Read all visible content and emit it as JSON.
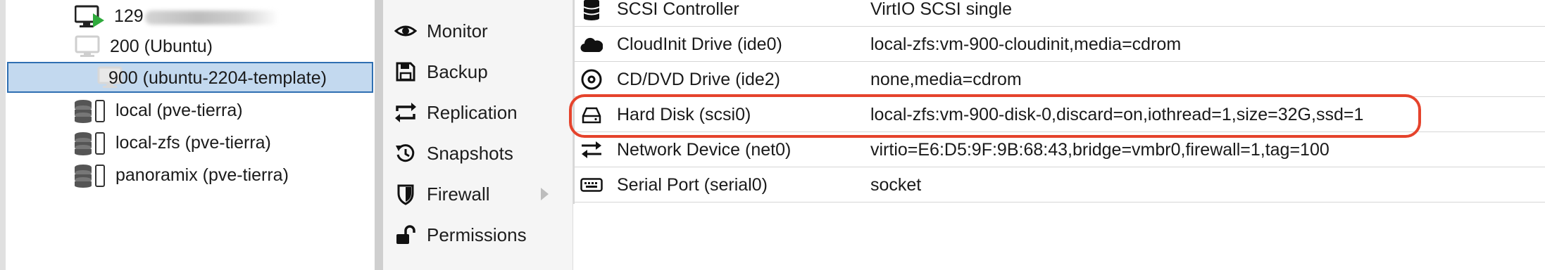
{
  "tree": {
    "items": [
      {
        "label": "129",
        "icon": "vm-running-icon",
        "redacted": true
      },
      {
        "label": "200 (Ubuntu)",
        "icon": "vm-stopped-icon"
      },
      {
        "label": "900 (ubuntu-2204-template)",
        "icon": "vm-template-icon",
        "selected": true
      },
      {
        "label": "local (pve-tierra)",
        "icon": "storage-icon"
      },
      {
        "label": "local-zfs (pve-tierra)",
        "icon": "storage-icon"
      },
      {
        "label": "panoramix (pve-tierra)",
        "icon": "storage-icon"
      }
    ]
  },
  "menu": {
    "items": [
      {
        "label": "Monitor",
        "icon": "eye-icon"
      },
      {
        "label": "Backup",
        "icon": "floppy-icon"
      },
      {
        "label": "Replication",
        "icon": "replication-icon"
      },
      {
        "label": "Snapshots",
        "icon": "history-icon"
      },
      {
        "label": "Firewall",
        "icon": "shield-icon",
        "has_submenu": true
      },
      {
        "label": "Permissions",
        "icon": "unlock-icon"
      }
    ]
  },
  "hardware": {
    "rows": [
      {
        "name": "SCSI Controller",
        "value": "VirtIO SCSI single",
        "icon": "database-icon"
      },
      {
        "name": "CloudInit Drive (ide0)",
        "value": "local-zfs:vm-900-cloudinit,media=cdrom",
        "icon": "cloud-icon"
      },
      {
        "name": "CD/DVD Drive (ide2)",
        "value": "none,media=cdrom",
        "icon": "disc-icon"
      },
      {
        "name": "Hard Disk (scsi0)",
        "value": "local-zfs:vm-900-disk-0,discard=on,iothread=1,size=32G,ssd=1",
        "icon": "hdd-icon",
        "highlighted": true
      },
      {
        "name": "Network Device (net0)",
        "value": "virtio=E6:D5:9F:9B:68:43,bridge=vmbr0,firewall=1,tag=100",
        "icon": "exchange-icon"
      },
      {
        "name": "Serial Port (serial0)",
        "value": "socket",
        "icon": "keyboard-icon"
      }
    ]
  },
  "colors": {
    "selection_bg": "#c3d9ef",
    "selection_border": "#2f6fb2",
    "highlight_ring": "#e5432c",
    "running_badge": "#2faa3c"
  }
}
